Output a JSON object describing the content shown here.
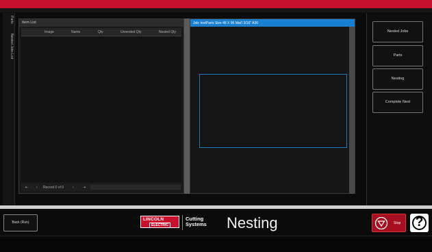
{
  "colors": {
    "accent_red": "#c8102e",
    "title_blue": "#1a7fcf",
    "sheet_outline": "#1f7ab8"
  },
  "left_tabs": [
    "Parts",
    "Nested Jobs List"
  ],
  "item_list": {
    "title": "Item List",
    "columns": [
      "Image",
      "Name",
      "Qty",
      "Unnested Qty",
      "Nested Qty"
    ],
    "rows": [],
    "pager": {
      "first": "⇤",
      "prev": "‹",
      "record": "Record 0 of 0",
      "next": "›",
      "last": "⇥"
    }
  },
  "nest_view": {
    "title": "Job: testParts  Size 48 X 96  Mat'l 3/16\" A36"
  },
  "side_buttons": [
    "Nested Jobs",
    "Parts",
    "Nesting",
    "Complete Nest"
  ],
  "footer": {
    "back_label": "Back (Run)",
    "logo_line1": "LINCOLN",
    "logo_line2": "ELECTRIC",
    "brand_line1": "Cutting",
    "brand_line2": "Systems",
    "page_title": "Nesting",
    "stop_label": "Stop",
    "help_label": "?"
  }
}
